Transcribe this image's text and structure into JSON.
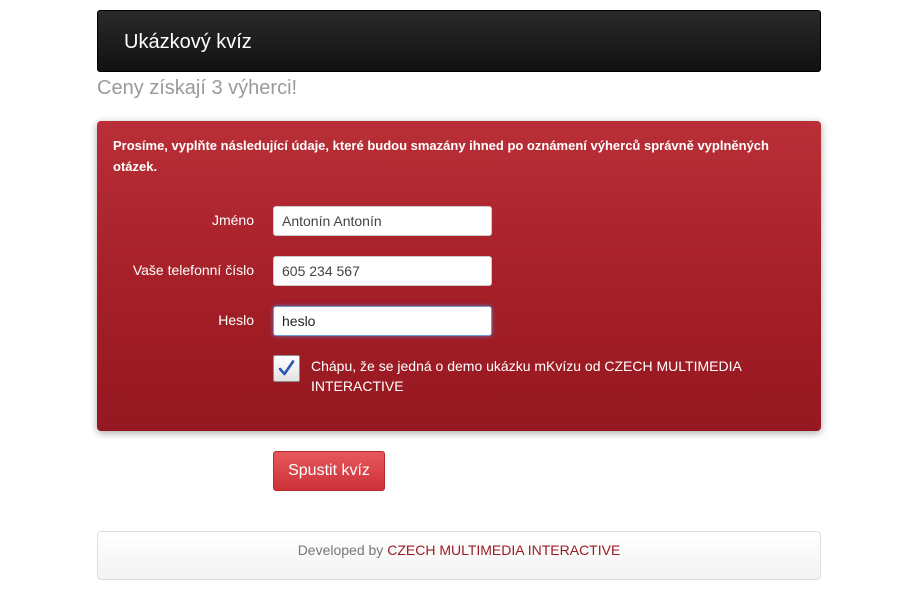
{
  "navbar": {
    "brand": "Ukázkový kvíz"
  },
  "subtitle": "Ceny získají 3 výherci!",
  "form": {
    "intro": "Prosíme, vyplňte následující údaje, které budou smazány ihned po oznámení výherců správně vyplněných otázek.",
    "fields": [
      {
        "label": "Jméno",
        "value": "Antonín Antonín"
      },
      {
        "label": "Vaše telefonní číslo",
        "value": "605 234 567"
      },
      {
        "label": "Heslo",
        "value": "heslo"
      }
    ],
    "consent": {
      "label": "Chápu, že se jedná o demo ukázku mKvízu od CZECH MULTIMEDIA INTERACTIVE",
      "checked": true
    },
    "submit_label": "Spustit kvíz"
  },
  "footer": {
    "prefix": "Developed by",
    "link_text": "CZECH MULTIMEDIA INTERACTIVE"
  },
  "colors": {
    "panel_red": "#a51f28",
    "button_red": "#d8434a",
    "link_red": "#9b1c25",
    "navbar_dark": "#1a1a1a"
  },
  "icons": {
    "checkbox_mark": "check-icon"
  }
}
